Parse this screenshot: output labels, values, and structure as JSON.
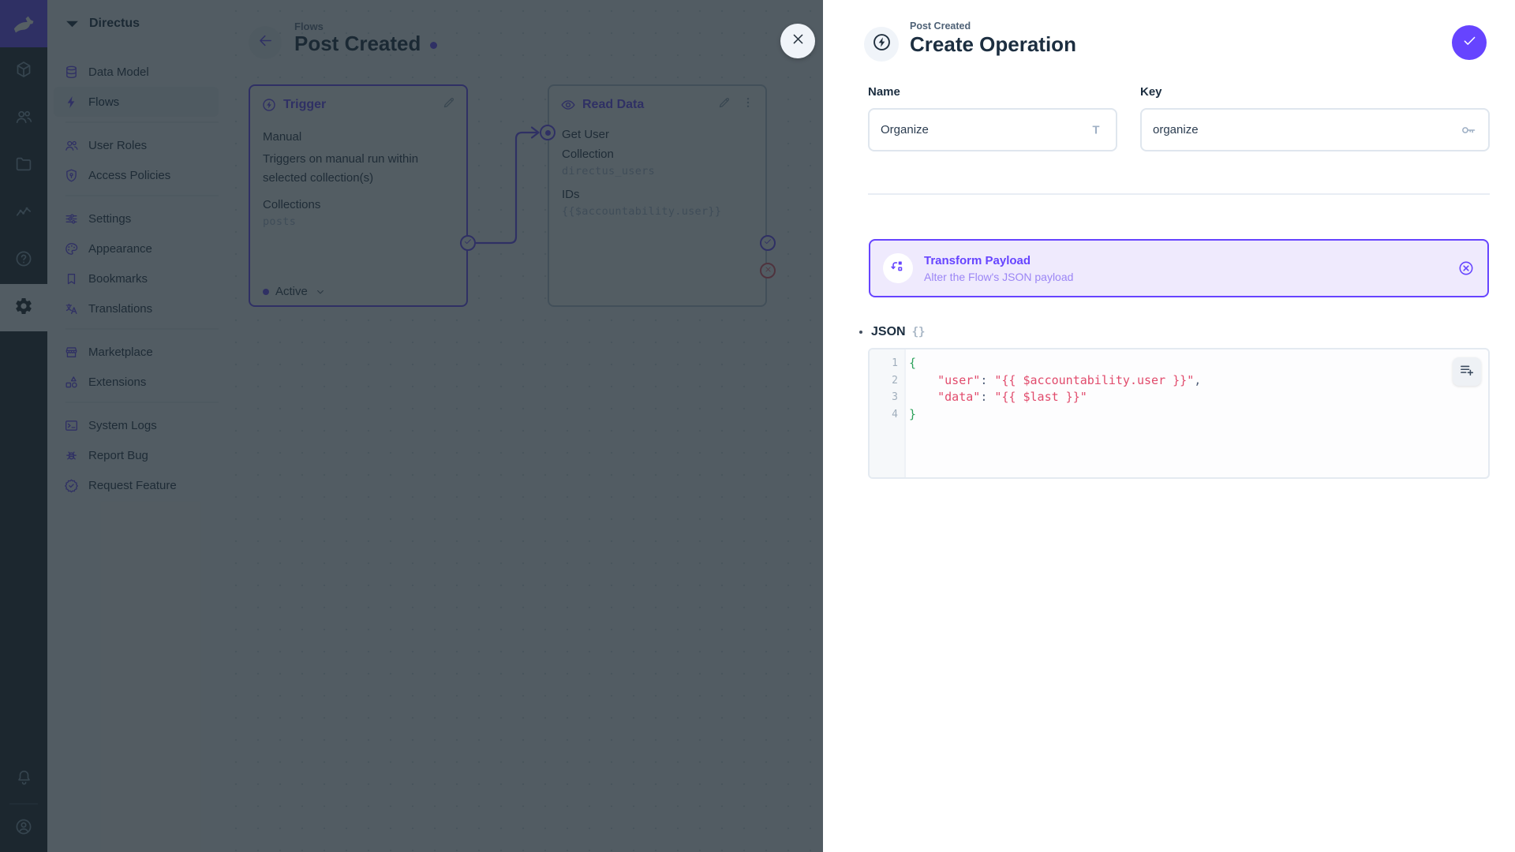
{
  "colors": {
    "brand": "#6644ff",
    "danger": "#e35169",
    "code_green": "#2ea25c",
    "code_red": "#e14b6c"
  },
  "module_bar": {
    "logo_icon": "rabbit-logo",
    "modules": [
      {
        "icon": "cube",
        "active": false
      },
      {
        "icon": "people",
        "active": false
      },
      {
        "icon": "folder",
        "active": false
      },
      {
        "icon": "insights",
        "active": false
      },
      {
        "icon": "help",
        "active": false
      },
      {
        "icon": "gear",
        "active": true
      }
    ],
    "bottom_icons": [
      {
        "icon": "bell"
      },
      {
        "icon": "account"
      }
    ]
  },
  "nav": {
    "project_icon": "wedge",
    "project_name": "Directus",
    "sections": [
      {
        "items": [
          {
            "icon": "database",
            "label": "Data Model",
            "active": false
          },
          {
            "icon": "bolt",
            "label": "Flows",
            "active": true
          }
        ]
      },
      {
        "items": [
          {
            "icon": "people",
            "label": "User Roles",
            "active": false
          },
          {
            "icon": "shield-key",
            "label": "Access Policies",
            "active": false
          }
        ]
      },
      {
        "items": [
          {
            "icon": "tune",
            "label": "Settings",
            "active": false
          },
          {
            "icon": "palette",
            "label": "Appearance",
            "active": false
          },
          {
            "icon": "bookmark",
            "label": "Bookmarks",
            "active": false
          },
          {
            "icon": "translate",
            "label": "Translations",
            "active": false
          }
        ]
      },
      {
        "items": [
          {
            "icon": "storefront",
            "label": "Marketplace",
            "active": false
          },
          {
            "icon": "shapes",
            "label": "Extensions",
            "active": false
          }
        ]
      },
      {
        "items": [
          {
            "icon": "terminal",
            "label": "System Logs",
            "active": false
          },
          {
            "icon": "bug",
            "label": "Report Bug",
            "active": false
          },
          {
            "icon": "badge-check",
            "label": "Request Feature",
            "active": false
          }
        ]
      }
    ]
  },
  "flow": {
    "back_icon": "arrow-left",
    "breadcrumb": "Flows",
    "title": "Post Created",
    "trigger_panel": {
      "icon": "bolt-circle",
      "title": "Trigger",
      "edit_icon": "pencil",
      "type": "Manual",
      "description": "Triggers on manual run within selected collection(s)",
      "field_label": "Collections",
      "field_value": "posts",
      "status_label": "Active",
      "status_icon": "chevron-down",
      "resolve_icon": "check"
    },
    "read_panel": {
      "icon": "eye",
      "title": "Read Data",
      "edit_icon": "pencil",
      "menu_icon": "kebab",
      "name": "Get User",
      "collection_label": "Collection",
      "collection_value": "directus_users",
      "ids_label": "IDs",
      "ids_value": "{{$accountability.user}}",
      "input_icon": "dot-circle",
      "resolve_icon": "check",
      "reject_icon": "x"
    }
  },
  "drawer": {
    "close_icon": "x",
    "header_icon": "bolt-circle",
    "breadcrumb": "Post Created",
    "title": "Create Operation",
    "save_icon": "check",
    "name_field": {
      "label": "Name",
      "value": "Organize",
      "icon": "title"
    },
    "key_field": {
      "label": "Key",
      "value": "organize",
      "icon": "key"
    },
    "card": {
      "icon": "transform",
      "title": "Transform Payload",
      "subtitle": "Alter the Flow's JSON payload",
      "remove_icon": "circled-x"
    },
    "json": {
      "label": "JSON",
      "icon_text": "{}",
      "add_icon": "playlist-add",
      "lines": [
        {
          "n": "1",
          "seg": [
            {
              "t": "{",
              "c": "br"
            }
          ]
        },
        {
          "n": "2",
          "seg": [
            {
              "t": "    ",
              "c": "pl"
            },
            {
              "t": "\"user\"",
              "c": "str"
            },
            {
              "t": ": ",
              "c": "pu"
            },
            {
              "t": "\"{{ $accountability.user }}\"",
              "c": "str"
            },
            {
              "t": ",",
              "c": "pu"
            }
          ]
        },
        {
          "n": "3",
          "seg": [
            {
              "t": "    ",
              "c": "pl"
            },
            {
              "t": "\"data\"",
              "c": "str"
            },
            {
              "t": ": ",
              "c": "pu"
            },
            {
              "t": "\"{{ $last }}\"",
              "c": "str"
            }
          ]
        },
        {
          "n": "4",
          "seg": [
            {
              "t": "}",
              "c": "br"
            }
          ]
        }
      ]
    }
  }
}
